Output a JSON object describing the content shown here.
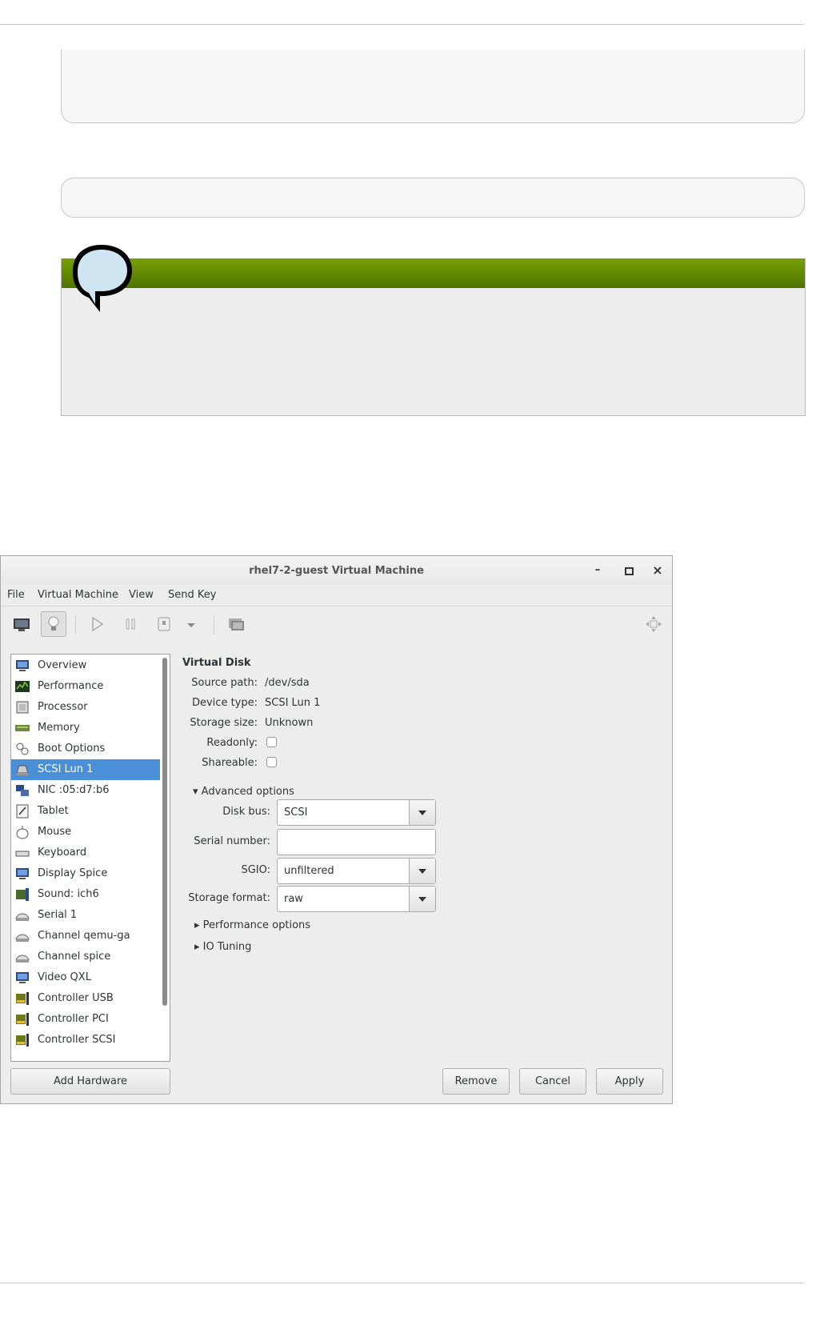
{
  "window": {
    "title": "rhel7-2-guest Virtual Machine",
    "minimize": "–",
    "maximize": "▫",
    "close": "×"
  },
  "menubar": [
    "File",
    "Virtual Machine",
    "View",
    "Send Key"
  ],
  "sidebar": {
    "items": [
      {
        "label": "Overview",
        "icon": "monitor-icon"
      },
      {
        "label": "Performance",
        "icon": "performance-graph-icon"
      },
      {
        "label": "Processor",
        "icon": "processor-icon"
      },
      {
        "label": "Memory",
        "icon": "memory-icon"
      },
      {
        "label": "Boot Options",
        "icon": "gears-icon"
      },
      {
        "label": "SCSI Lun 1",
        "icon": "disk-icon",
        "selected": true
      },
      {
        "label": "NIC :05:d7:b6",
        "icon": "network-icon"
      },
      {
        "label": "Tablet",
        "icon": "tablet-icon"
      },
      {
        "label": "Mouse",
        "icon": "mouse-icon"
      },
      {
        "label": "Keyboard",
        "icon": "keyboard-icon"
      },
      {
        "label": "Display Spice",
        "icon": "display-icon"
      },
      {
        "label": "Sound: ich6",
        "icon": "sound-icon"
      },
      {
        "label": "Serial 1",
        "icon": "serial-icon"
      },
      {
        "label": "Channel qemu-ga",
        "icon": "channel-icon"
      },
      {
        "label": "Channel spice",
        "icon": "channel-icon"
      },
      {
        "label": "Video QXL",
        "icon": "video-icon"
      },
      {
        "label": "Controller USB",
        "icon": "controller-icon"
      },
      {
        "label": "Controller PCI",
        "icon": "controller-icon"
      },
      {
        "label": "Controller SCSI",
        "icon": "controller-icon"
      }
    ],
    "add_hardware": "Add Hardware"
  },
  "details": {
    "section_title": "Virtual Disk",
    "source_path_label": "Source path:",
    "source_path": "/dev/sda",
    "device_type_label": "Device type:",
    "device_type": "SCSI Lun 1",
    "storage_size_label": "Storage size:",
    "storage_size": "Unknown",
    "readonly_label": "Readonly:",
    "shareable_label": "Shareable:",
    "advanced_options": "Advanced options",
    "disk_bus_label": "Disk bus:",
    "disk_bus": "SCSI",
    "serial_number_label": "Serial number:",
    "serial_number": "",
    "sgio_label": "SGIO:",
    "sgio": "unfiltered",
    "storage_format_label": "Storage format:",
    "storage_format": "raw",
    "performance_options": "Performance options",
    "io_tuning": "IO Tuning"
  },
  "buttons": {
    "remove": "Remove",
    "cancel": "Cancel",
    "apply": "Apply"
  }
}
